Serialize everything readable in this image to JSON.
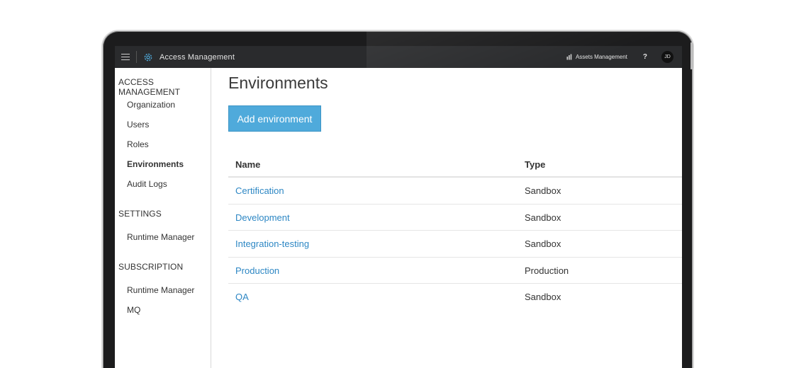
{
  "topbar": {
    "app_title": "Access Management",
    "assets_label": "Assets Management",
    "help_label": "?",
    "avatar_initials": "JD"
  },
  "sidebar": {
    "sections": [
      {
        "heading": "ACCESS MANAGEMENT",
        "items": [
          {
            "label": "Organization",
            "active": false
          },
          {
            "label": "Users",
            "active": false
          },
          {
            "label": "Roles",
            "active": false
          },
          {
            "label": "Environments",
            "active": true
          },
          {
            "label": "Audit Logs",
            "active": false
          }
        ]
      },
      {
        "heading": "SETTINGS",
        "items": [
          {
            "label": "Runtime Manager",
            "active": false
          }
        ]
      },
      {
        "heading": "SUBSCRIPTION",
        "items": [
          {
            "label": "Runtime Manager",
            "active": false
          },
          {
            "label": "MQ",
            "active": false
          }
        ]
      }
    ]
  },
  "main": {
    "title": "Environments",
    "add_button_label": "Add environment",
    "table": {
      "columns": [
        "Name",
        "Type"
      ],
      "rows": [
        {
          "name": "Certification",
          "type": "Sandbox"
        },
        {
          "name": "Development",
          "type": "Sandbox"
        },
        {
          "name": "Integration-testing",
          "type": "Sandbox"
        },
        {
          "name": "Production",
          "type": "Production"
        },
        {
          "name": "QA",
          "type": "Sandbox"
        }
      ]
    }
  },
  "colors": {
    "topbar_bg": "#2a2b2d",
    "accent_button": "#4faadb",
    "link": "#2d87c4",
    "frame": "#1c1c1d"
  }
}
